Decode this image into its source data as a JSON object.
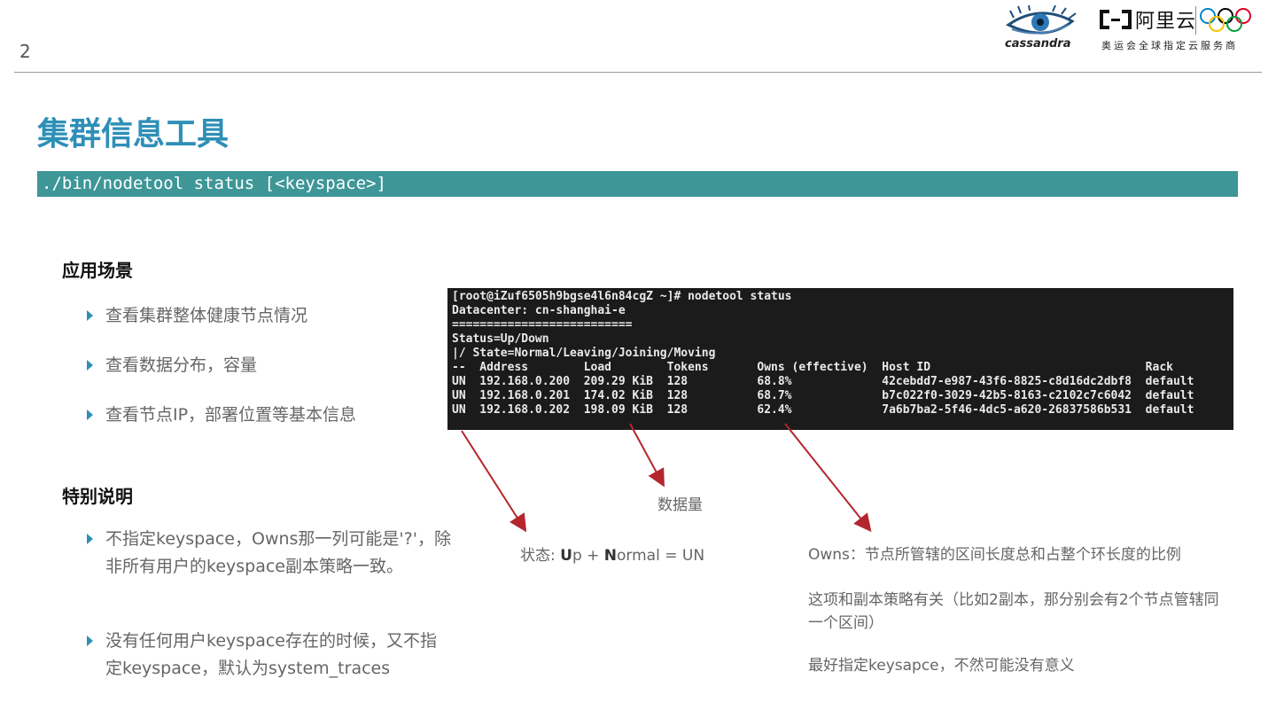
{
  "page_number": "2",
  "logos": {
    "cassandra": "cassandra",
    "aliyun_name": "阿里云",
    "aliyun_tagline": "奥运会全球指定云服务商"
  },
  "title": "集群信息工具",
  "command": "./bin/nodetool status [<keyspace>]",
  "sections": {
    "use_cases": {
      "heading": "应用场景",
      "items": [
        "查看集群整体健康节点情况",
        "查看数据分布，容量",
        "查看节点IP，部署位置等基本信息"
      ]
    },
    "notes": {
      "heading": "特别说明",
      "items": [
        "不指定keyspace，Owns那一列可能是'?'，除非所有用户的keyspace副本策略一致。",
        "没有任何用户keyspace存在的时候，又不指定keyspace，默认为system_traces"
      ]
    }
  },
  "terminal": {
    "lines": [
      "[root@iZuf6505h9bgse4l6n84cgZ ~]# nodetool status",
      "Datacenter: cn-shanghai-e",
      "==========================",
      "Status=Up/Down",
      "|/ State=Normal/Leaving/Joining/Moving",
      "--  Address        Load        Tokens       Owns (effective)  Host ID                               Rack",
      "UN  192.168.0.200  209.29 KiB  128          68.8%             42cebdd7-e987-43f6-8825-c8d16dc2dbf8  default",
      "UN  192.168.0.201  174.02 KiB  128          68.7%             b7c022f0-3029-42b5-8163-c2102c7c6042  default",
      "UN  192.168.0.202  198.09 KiB  128          62.4%             7a6b7ba2-5f46-4dc5-a620-26837586b531  default"
    ]
  },
  "annotations": {
    "data_amount": "数据量",
    "status_prefix": "状态: ",
    "status_u": "U",
    "status_mid": "p + ",
    "status_n": "N",
    "status_suffix": "ormal = UN",
    "owns": "Owns：节点所管辖的区间长度总和占整个环长度的比例",
    "replica": "这项和副本策略有关（比如2副本，那分别会有2个节点管辖同一个区间）",
    "best": "最好指定keysapce，不然可能没有意义"
  },
  "colors": {
    "accent_blue": "#2e8fb7",
    "command_bar": "#3e9697",
    "arrow_red": "#b3262d",
    "terminal_bg": "#1b1b1b"
  }
}
